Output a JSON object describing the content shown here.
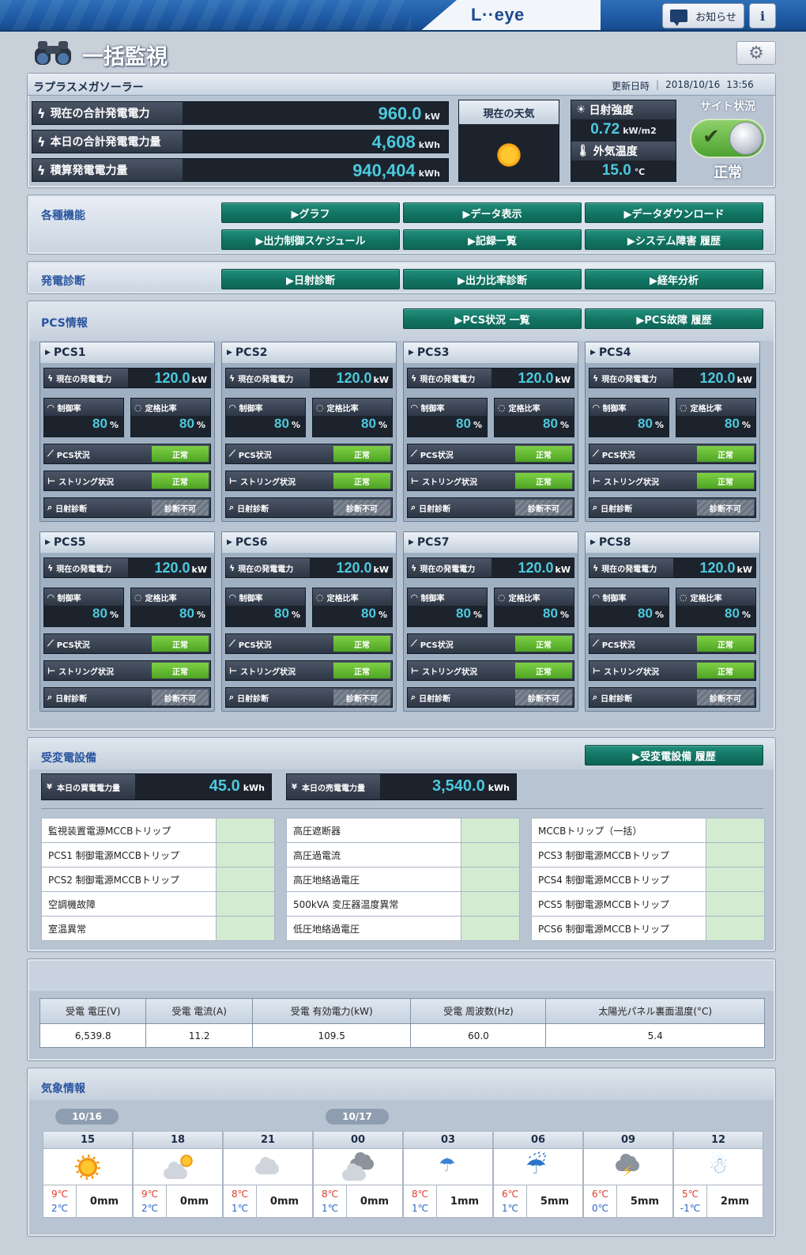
{
  "header": {
    "logo": "L··eye",
    "notice_label": "お知らせ",
    "info_label": "i",
    "page_title": "一括監視"
  },
  "summary": {
    "site_name": "ラプラスメガソーラー",
    "updated_label": "更新日時",
    "updated_date": "2018/10/16",
    "updated_time": "13:56",
    "metrics": [
      {
        "label": "現在の合計発電電力",
        "value": "960.0",
        "unit": "kW"
      },
      {
        "label": "本日の合計発電電力量",
        "value": "4,608",
        "unit": "kWh"
      },
      {
        "label": "積算発電電力量",
        "value": "940,404",
        "unit": "kWh"
      }
    ],
    "weather_label": "現在の天気",
    "weather_icon": "sun-icon",
    "irradiance_label": "日射強度",
    "irradiance_value": "0.72",
    "irradiance_unit": "kW/m2",
    "temp_label": "外気温度",
    "temp_value": "15.0",
    "temp_unit": "℃",
    "site_status_label": "サイト状況",
    "site_status_value": "正常"
  },
  "functions": {
    "label": "各種機能",
    "buttons": [
      "▶グラフ",
      "▶データ表示",
      "▶データダウンロード",
      "▶出力制御スケジュール",
      "▶記録一覧",
      "▶システム障害 履歴"
    ]
  },
  "diagnosis": {
    "label": "発電診断",
    "buttons": [
      "▶日射診断",
      "▶出力比率診断",
      "▶経年分析"
    ]
  },
  "pcs": {
    "label": "PCS情報",
    "buttons": [
      "▶PCS状況 一覧",
      "▶PCS故障 履歴"
    ],
    "power_label": "現在の発電電力",
    "control_label": "制御率",
    "rated_label": "定格比率",
    "status_label": "PCS状況",
    "string_label": "ストリング状況",
    "sun_diag_label": "日射診断",
    "units": [
      {
        "name": "PCS1",
        "power": "120.0",
        "power_unit": "kW",
        "control": "80",
        "rated": "80",
        "pct": "%",
        "status": "正常",
        "string": "正常",
        "diag": "診断不可"
      },
      {
        "name": "PCS2",
        "power": "120.0",
        "power_unit": "kW",
        "control": "80",
        "rated": "80",
        "pct": "%",
        "status": "正常",
        "string": "正常",
        "diag": "診断不可"
      },
      {
        "name": "PCS3",
        "power": "120.0",
        "power_unit": "kW",
        "control": "80",
        "rated": "80",
        "pct": "%",
        "status": "正常",
        "string": "正常",
        "diag": "診断不可"
      },
      {
        "name": "PCS4",
        "power": "120.0",
        "power_unit": "kW",
        "control": "80",
        "rated": "80",
        "pct": "%",
        "status": "正常",
        "string": "正常",
        "diag": "診断不可"
      },
      {
        "name": "PCS5",
        "power": "120.0",
        "power_unit": "kW",
        "control": "80",
        "rated": "80",
        "pct": "%",
        "status": "正常",
        "string": "正常",
        "diag": "診断不可"
      },
      {
        "name": "PCS6",
        "power": "120.0",
        "power_unit": "kW",
        "control": "80",
        "rated": "80",
        "pct": "%",
        "status": "正常",
        "string": "正常",
        "diag": "診断不可"
      },
      {
        "name": "PCS7",
        "power": "120.0",
        "power_unit": "kW",
        "control": "80",
        "rated": "80",
        "pct": "%",
        "status": "正常",
        "string": "正常",
        "diag": "診断不可"
      },
      {
        "name": "PCS8",
        "power": "120.0",
        "power_unit": "kW",
        "control": "80",
        "rated": "80",
        "pct": "%",
        "status": "正常",
        "string": "正常",
        "diag": "診断不可"
      }
    ]
  },
  "substation": {
    "label": "受変電設備",
    "history_button": "▶受変電設備 履歴",
    "buy_label": "本日の買電電力量",
    "buy_value": "45.0",
    "sell_label": "本日の売電電力量",
    "sell_value": "3,540.0",
    "kwh_unit": "kWh",
    "alarm_columns": [
      [
        "監視装置電源MCCBトリップ",
        "PCS1 制御電源MCCBトリップ",
        "PCS2 制御電源MCCBトリップ",
        "空調機故障",
        "室温異常"
      ],
      [
        "高圧遮断器",
        "高圧過電流",
        "高圧地絡過電圧",
        "500kVA 変圧器温度異常",
        "低圧地絡過電圧"
      ],
      [
        "MCCBトリップ（一括）",
        "PCS3 制御電源MCCBトリップ",
        "PCS4 制御電源MCCBトリップ",
        "PCS5 制御電源MCCBトリップ",
        "PCS6 制御電源MCCBトリップ"
      ]
    ]
  },
  "measurements": {
    "headers": [
      "受電 電圧(V)",
      "受電 電流(A)",
      "受電 有効電力(kW)",
      "受電 周波数(Hz)",
      "太陽光パネル裏面温度(°C)"
    ],
    "values": [
      "6,539.8",
      "11.2",
      "109.5",
      "60.0",
      "5.4"
    ]
  },
  "forecast": {
    "label": "気象情報",
    "dates": [
      "10/16",
      "10/17"
    ],
    "slots": [
      {
        "hour": "15",
        "icon": "sun-icon",
        "hi": "9℃",
        "lo": "2℃",
        "rain": "0mm"
      },
      {
        "hour": "18",
        "icon": "sun-cloud-icon",
        "hi": "9℃",
        "lo": "2℃",
        "rain": "0mm"
      },
      {
        "hour": "21",
        "icon": "cloud-icon",
        "hi": "8℃",
        "lo": "1℃",
        "rain": "0mm"
      },
      {
        "hour": "00",
        "icon": "clouds-icon",
        "hi": "8℃",
        "lo": "1℃",
        "rain": "0mm"
      },
      {
        "hour": "03",
        "icon": "rain-icon",
        "hi": "8℃",
        "lo": "1℃",
        "rain": "1mm"
      },
      {
        "hour": "06",
        "icon": "umbrella-icon",
        "hi": "6℃",
        "lo": "1℃",
        "rain": "5mm"
      },
      {
        "hour": "09",
        "icon": "thunder-icon",
        "hi": "6℃",
        "lo": "0℃",
        "rain": "5mm"
      },
      {
        "hour": "12",
        "icon": "snowman-icon",
        "hi": "5℃",
        "lo": "-1℃",
        "rain": "2mm"
      }
    ]
  }
}
